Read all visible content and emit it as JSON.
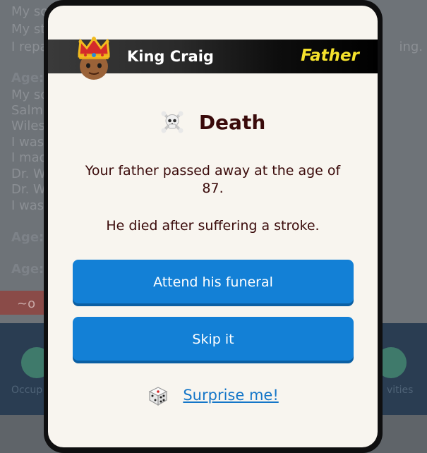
{
  "background": {
    "left_lines": [
      "My so",
      "My st",
      "I repa",
      "Age:",
      "My so",
      "Salm",
      "Wiles",
      "I was",
      "I mad",
      "Dr. W",
      "Dr. W",
      "I was",
      "Age:",
      "Age:"
    ],
    "right_text": "ing.",
    "bottom_left_label": "Occup",
    "bottom_right_label": "vities"
  },
  "modal": {
    "header": {
      "name": "King Craig",
      "relation": "Father"
    },
    "title": "Death",
    "message_line1": "Your father passed away at the age of 87.",
    "message_line2": "He died after suffering a stroke.",
    "buttons": {
      "attend": "Attend his funeral",
      "skip": "Skip it"
    },
    "surprise": "Surprise me!"
  },
  "colors": {
    "button": "#1380d6",
    "relation": "#f5e22c",
    "title": "#3a0a0a",
    "link": "#1476c8"
  }
}
